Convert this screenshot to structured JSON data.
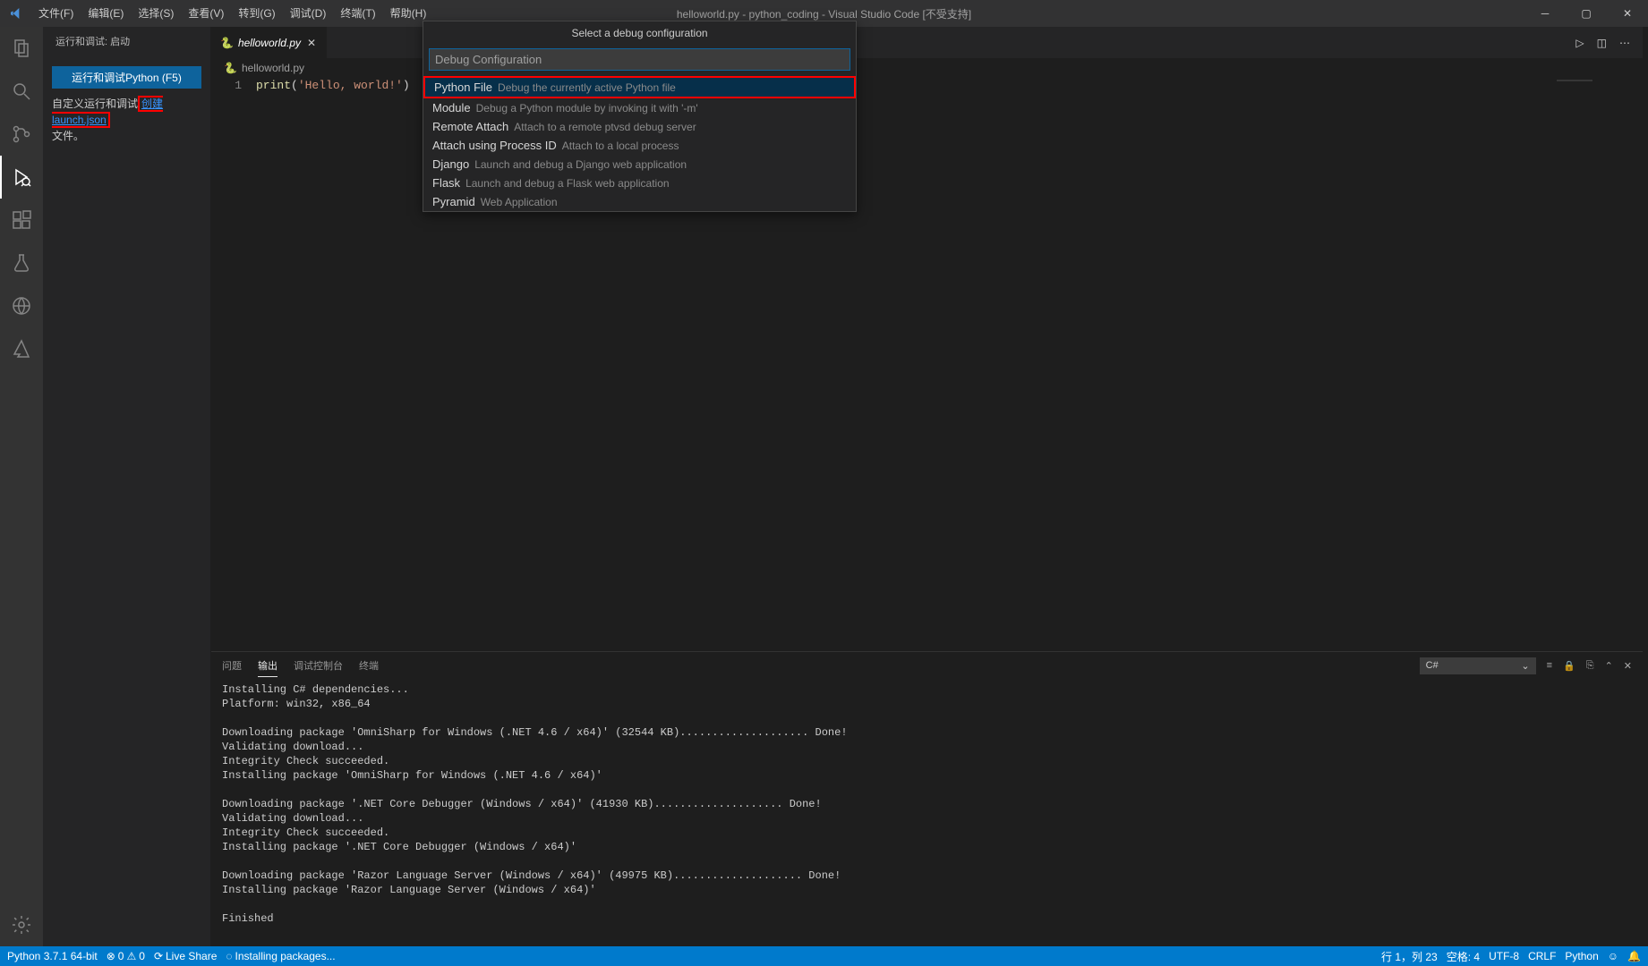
{
  "titlebar": {
    "menus": [
      "文件(F)",
      "编辑(E)",
      "选择(S)",
      "查看(V)",
      "转到(G)",
      "调试(D)",
      "终端(T)",
      "帮助(H)"
    ],
    "title": "helloworld.py - python_coding - Visual Studio Code [不受支持]"
  },
  "sidebar": {
    "header": "运行和调试: 启动",
    "debug_button": "运行和调试Python (F5)",
    "custom_text_a": "自定义运行和调试",
    "launch_link": "创建launch.json",
    "custom_text_b": "文件。"
  },
  "tab": {
    "filename": "helloworld.py"
  },
  "breadcrumb": {
    "file": "helloworld.py"
  },
  "code": {
    "line_no": "1",
    "fn": "print",
    "open": "(",
    "str": "'Hello, world!'",
    "close": ")"
  },
  "quickpick": {
    "title": "Select a debug configuration",
    "placeholder": "Debug Configuration",
    "items": [
      {
        "label": "Python File",
        "desc": "Debug the currently active Python file"
      },
      {
        "label": "Module",
        "desc": "Debug a Python module by invoking it with '-m'"
      },
      {
        "label": "Remote Attach",
        "desc": "Attach to a remote ptvsd debug server"
      },
      {
        "label": "Attach using Process ID",
        "desc": "Attach to a local process"
      },
      {
        "label": "Django",
        "desc": "Launch and debug a Django web application"
      },
      {
        "label": "Flask",
        "desc": "Launch and debug a Flask web application"
      },
      {
        "label": "Pyramid",
        "desc": "Web Application"
      }
    ]
  },
  "panel": {
    "tabs": [
      "问题",
      "输出",
      "调试控制台",
      "终端"
    ],
    "select": "C#",
    "output": "Installing C# dependencies...\nPlatform: win32, x86_64\n\nDownloading package 'OmniSharp for Windows (.NET 4.6 / x64)' (32544 KB).................... Done!\nValidating download...\nIntegrity Check succeeded.\nInstalling package 'OmniSharp for Windows (.NET 4.6 / x64)'\n\nDownloading package '.NET Core Debugger (Windows / x64)' (41930 KB).................... Done!\nValidating download...\nIntegrity Check succeeded.\nInstalling package '.NET Core Debugger (Windows / x64)'\n\nDownloading package 'Razor Language Server (Windows / x64)' (49975 KB).................... Done!\nInstalling package 'Razor Language Server (Windows / x64)'\n\nFinished"
  },
  "statusbar": {
    "python": "Python 3.7.1 64-bit",
    "errors": "0",
    "warnings": "0",
    "liveshare": "Live Share",
    "installing": "Installing packages...",
    "line_col": "行 1，列 23",
    "spaces": "空格: 4",
    "encoding": "UTF-8",
    "eol": "CRLF",
    "lang": "Python",
    "feedback": "☺"
  }
}
